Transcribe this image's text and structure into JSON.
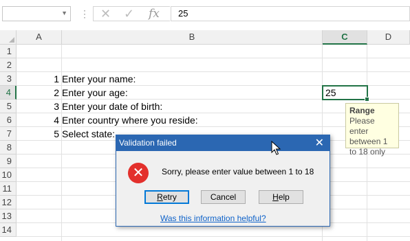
{
  "formula_bar": {
    "name_box": "",
    "dots": "⋮",
    "cancel_glyph": "✕",
    "enter_glyph": "✓",
    "fx_label": "fx",
    "value": "25"
  },
  "columns": [
    "A",
    "B",
    "C",
    "D"
  ],
  "rows": [
    "1",
    "2",
    "3",
    "4",
    "5",
    "6",
    "7",
    "8",
    "9",
    "10",
    "11",
    "12",
    "13",
    "14"
  ],
  "cells": [
    {
      "row": 3,
      "a": "1",
      "b": "Enter your name:"
    },
    {
      "row": 4,
      "a": "2",
      "b": "Enter your age:"
    },
    {
      "row": 5,
      "a": "3",
      "b": "Enter your date of birth:"
    },
    {
      "row": 6,
      "a": "4",
      "b": "Enter country where you reside:"
    },
    {
      "row": 7,
      "a": "5",
      "b": "Select state:"
    }
  ],
  "active_cell": {
    "column": "C",
    "row": "4",
    "value": "25"
  },
  "input_tooltip": {
    "title": "Range",
    "message": "Please enter between 1 to 18 only"
  },
  "dialog": {
    "title": "Validation failed",
    "close_glyph": "✕",
    "icon": "error-icon",
    "icon_glyph": "✕",
    "message": "Sorry, please enter value between 1 to 18",
    "buttons": {
      "retry_prefix": "",
      "retry_mnemonic": "R",
      "retry_rest": "etry",
      "cancel": "Cancel",
      "help_mnemonic": "H",
      "help_rest": "elp"
    },
    "link": "Was this information helpful?"
  },
  "colors": {
    "accent": "#217346",
    "dialog_title_bar": "#2b67b2",
    "error": "#e3302c",
    "link": "#0e62c9",
    "tooltip_bg": "#ffffe1"
  }
}
